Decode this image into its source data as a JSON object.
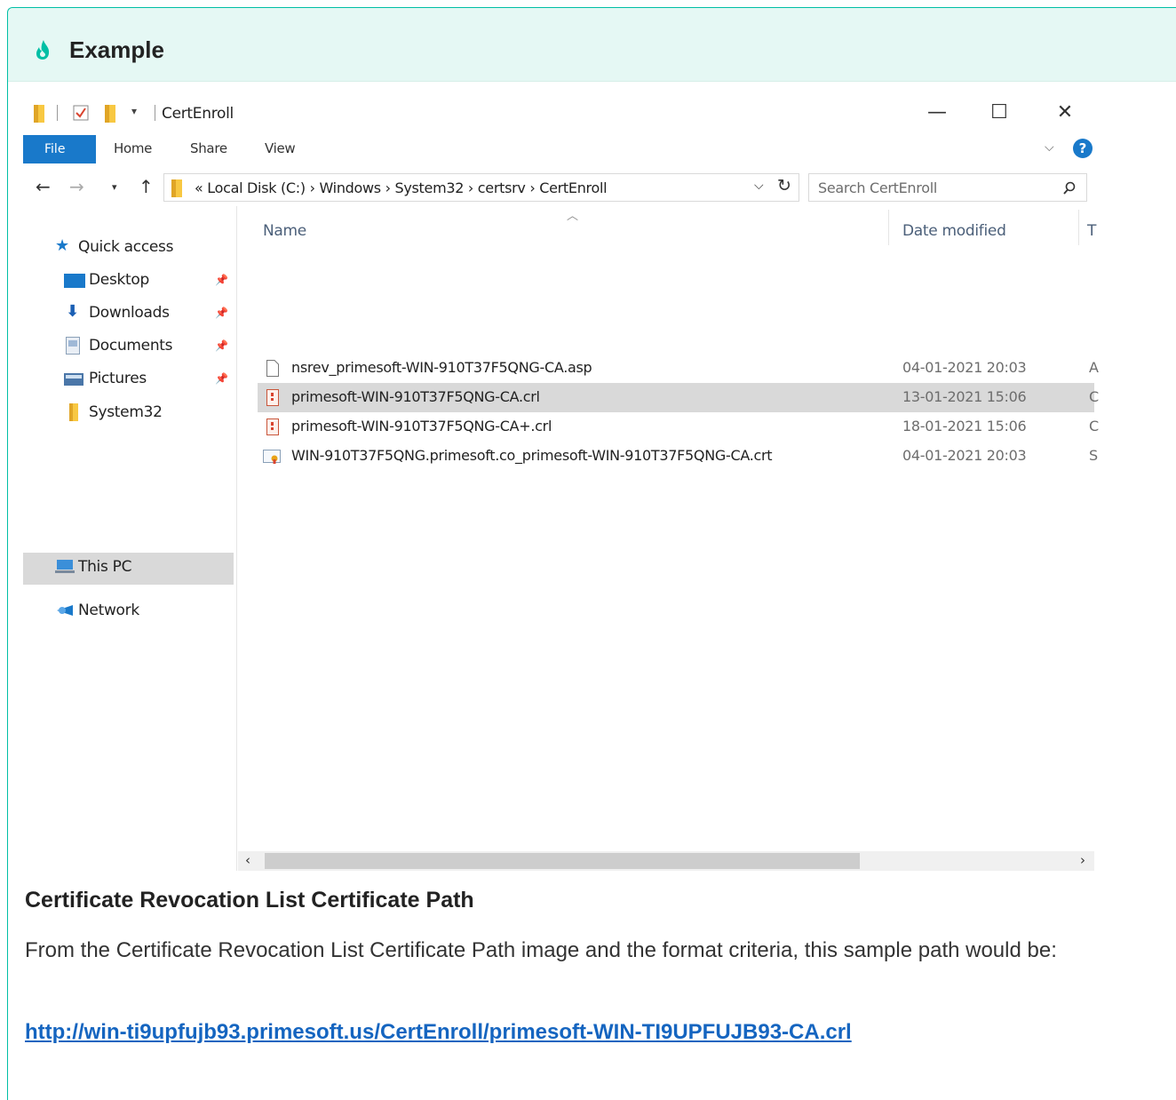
{
  "admonition": {
    "title": "Example",
    "icon": "flame-icon",
    "accent": "#00bfa5",
    "background": "#e5f8f4"
  },
  "window": {
    "title": "CertEnroll",
    "controls": {
      "minimize": "—",
      "maximize": "☐",
      "close": "✕"
    },
    "ribbon": {
      "tabs": [
        "File",
        "Home",
        "Share",
        "View"
      ],
      "help": "?"
    },
    "address": {
      "path_text": "« Local Disk (C:)  ›  Windows  ›  System32  ›  certsrv  ›  CertEnroll",
      "search_placeholder": "Search CertEnroll"
    },
    "sidebar": {
      "items": [
        {
          "label": "Quick access",
          "icon": "star-icon"
        },
        {
          "label": "Desktop",
          "icon": "desktop-icon",
          "pinned": true
        },
        {
          "label": "Downloads",
          "icon": "download-icon",
          "pinned": true
        },
        {
          "label": "Documents",
          "icon": "document-icon",
          "pinned": true
        },
        {
          "label": "Pictures",
          "icon": "pictures-icon",
          "pinned": true
        },
        {
          "label": "System32",
          "icon": "folder-icon"
        },
        {
          "label": "This PC",
          "icon": "computer-icon",
          "selected": true
        },
        {
          "label": "Network",
          "icon": "network-icon"
        }
      ]
    },
    "columns": [
      "Name",
      "Date modified",
      "T"
    ],
    "files": [
      {
        "name": "nsrev_primesoft-WIN-910T37F5QNG-CA.asp",
        "date": "04-01-2021 20:03",
        "type": "A",
        "icon": "blank-file-icon"
      },
      {
        "name": "primesoft-WIN-910T37F5QNG-CA.crl",
        "date": "13-01-2021 15:06",
        "type": "C",
        "icon": "crl-file-icon",
        "selected": true
      },
      {
        "name": "primesoft-WIN-910T37F5QNG-CA+.crl",
        "date": "18-01-2021 15:06",
        "type": "C",
        "icon": "crl-file-icon"
      },
      {
        "name": "WIN-910T37F5QNG.primesoft.co_primesoft-WIN-910T37F5QNG-CA.crt",
        "date": "04-01-2021 20:03",
        "type": "S",
        "icon": "certificate-icon"
      }
    ],
    "scroll": {
      "left": "‹",
      "right": "›"
    }
  },
  "caption": "Certificate Revocation List Certificate Path",
  "paragraph": "From the Certificate Revocation List Certificate Path image and the format criteria, this sample path would be:",
  "link": "http://win-ti9upfujb93.primesoft.us/CertEnroll/primesoft-WIN-TI9UPFUJB93-CA.crl"
}
